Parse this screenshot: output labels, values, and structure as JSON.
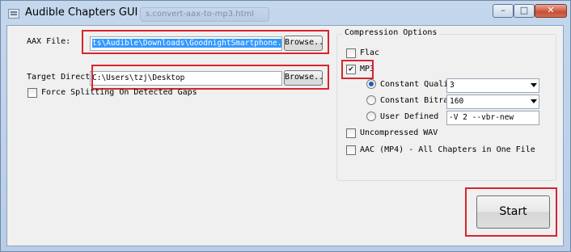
{
  "window": {
    "title": "Audible Chapters GUI",
    "background_tab_text": "s.convert-aax-to-mp3.html",
    "minimize": "–",
    "maximize": "□",
    "close": "✕"
  },
  "file": {
    "label": "AAX File:",
    "value": "ts\\Audible\\Downloads\\GoodnightSmartphone.aax",
    "browse_label": "Browse.."
  },
  "target": {
    "label": "Target Director",
    "value": "C:\\Users\\tzj\\Desktop",
    "browse_label": "Browse.."
  },
  "force_split": {
    "label": "Force Splitting On Detected Gaps",
    "checked": false
  },
  "compression": {
    "title": "Compression Options",
    "flac": {
      "label": "Flac",
      "checked": false
    },
    "mp3": {
      "label": "MP3",
      "checked": true
    },
    "constant_quality": {
      "label": "Constant Quality",
      "value": "3",
      "selected": true
    },
    "constant_bitrate": {
      "label": "Constant Bitrate",
      "value": "160",
      "selected": false
    },
    "user_defined": {
      "label": "User Defined",
      "value": "-V 2 --vbr-new",
      "selected": false
    },
    "uncompressed_wav": {
      "label": "Uncompressed WAV",
      "checked": false
    },
    "aac": {
      "label": "AAC (MP4) - All Chapters in One File",
      "checked": false
    }
  },
  "start_label": "Start",
  "colors": {
    "highlight": "#d6262e",
    "selection": "#3399ff",
    "radio_dot": "#1c5fb8"
  }
}
